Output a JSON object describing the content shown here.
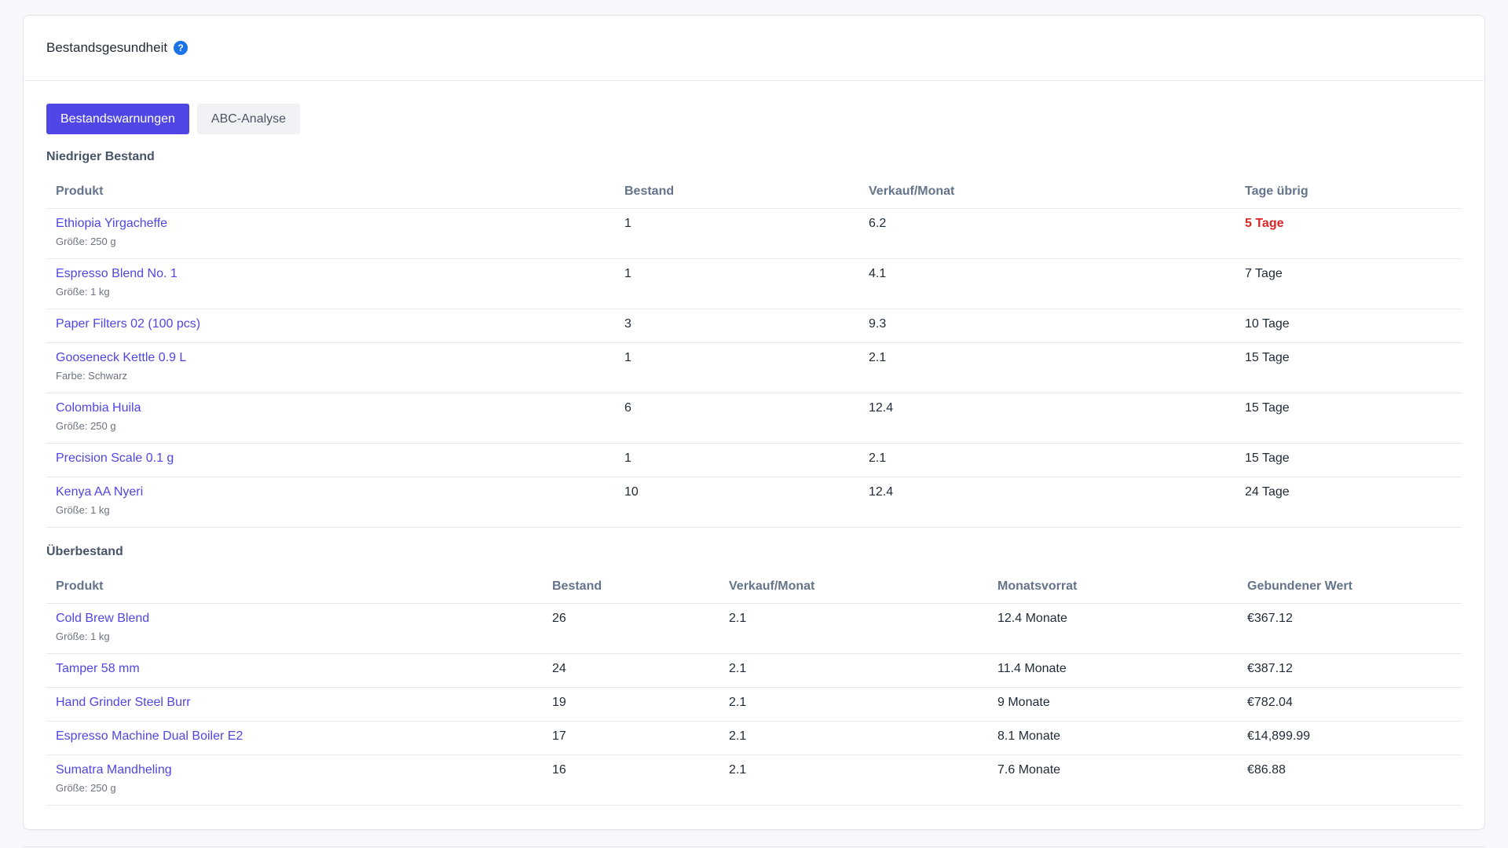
{
  "header": {
    "title": "Bestandsgesundheit",
    "help_icon": "?"
  },
  "tabs": [
    {
      "label": "Bestandswarnungen",
      "active": true
    },
    {
      "label": "ABC-Analyse",
      "active": false
    }
  ],
  "low_stock": {
    "title": "Niedriger Bestand",
    "columns": [
      "Produkt",
      "Bestand",
      "Verkauf/Monat",
      "Tage übrig"
    ],
    "rows": [
      {
        "name": "Ethiopia Yirgacheffe",
        "sub": "Größe: 250 g",
        "stock": "1",
        "sales": "6.2",
        "days": "5 Tage",
        "urgent": true
      },
      {
        "name": "Espresso Blend No. 1",
        "sub": "Größe: 1 kg",
        "stock": "1",
        "sales": "4.1",
        "days": "7 Tage",
        "urgent": false
      },
      {
        "name": "Paper Filters 02 (100 pcs)",
        "sub": "",
        "stock": "3",
        "sales": "9.3",
        "days": "10 Tage",
        "urgent": false
      },
      {
        "name": "Gooseneck Kettle 0.9 L",
        "sub": "Farbe: Schwarz",
        "stock": "1",
        "sales": "2.1",
        "days": "15 Tage",
        "urgent": false
      },
      {
        "name": "Colombia Huila",
        "sub": "Größe: 250 g",
        "stock": "6",
        "sales": "12.4",
        "days": "15 Tage",
        "urgent": false
      },
      {
        "name": "Precision Scale 0.1 g",
        "sub": "",
        "stock": "1",
        "sales": "2.1",
        "days": "15 Tage",
        "urgent": false
      },
      {
        "name": "Kenya AA Nyeri",
        "sub": "Größe: 1 kg",
        "stock": "10",
        "sales": "12.4",
        "days": "24 Tage",
        "urgent": false
      }
    ]
  },
  "overstock": {
    "title": "Überbestand",
    "columns": [
      "Produkt",
      "Bestand",
      "Verkauf/Monat",
      "Monatsvorrat",
      "Gebundener Wert"
    ],
    "rows": [
      {
        "name": "Cold Brew Blend",
        "sub": "Größe: 1 kg",
        "stock": "26",
        "sales": "2.1",
        "months": "12.4 Monate",
        "value": "€367.12"
      },
      {
        "name": "Tamper 58 mm",
        "sub": "",
        "stock": "24",
        "sales": "2.1",
        "months": "11.4 Monate",
        "value": "€387.12"
      },
      {
        "name": "Hand Grinder Steel Burr",
        "sub": "",
        "stock": "19",
        "sales": "2.1",
        "months": "9 Monate",
        "value": "€782.04"
      },
      {
        "name": "Espresso Machine Dual Boiler E2",
        "sub": "",
        "stock": "17",
        "sales": "2.1",
        "months": "8.1 Monate",
        "value": "€14,899.99"
      },
      {
        "name": "Sumatra Mandheling",
        "sub": "Größe: 250 g",
        "stock": "16",
        "sales": "2.1",
        "months": "7.6 Monate",
        "value": "€86.88"
      }
    ]
  },
  "colors": {
    "accent": "#4f46e5",
    "urgent": "#dc2626",
    "help": "#1a73e8"
  }
}
